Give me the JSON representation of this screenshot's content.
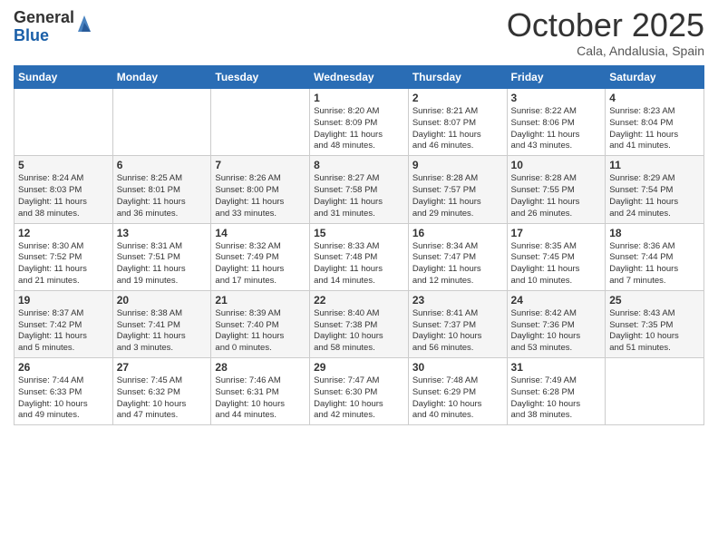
{
  "header": {
    "logo_general": "General",
    "logo_blue": "Blue",
    "month_title": "October 2025",
    "location": "Cala, Andalusia, Spain"
  },
  "days_of_week": [
    "Sunday",
    "Monday",
    "Tuesday",
    "Wednesday",
    "Thursday",
    "Friday",
    "Saturday"
  ],
  "weeks": [
    [
      {
        "day": "",
        "info": ""
      },
      {
        "day": "",
        "info": ""
      },
      {
        "day": "",
        "info": ""
      },
      {
        "day": "1",
        "info": "Sunrise: 8:20 AM\nSunset: 8:09 PM\nDaylight: 11 hours\nand 48 minutes."
      },
      {
        "day": "2",
        "info": "Sunrise: 8:21 AM\nSunset: 8:07 PM\nDaylight: 11 hours\nand 46 minutes."
      },
      {
        "day": "3",
        "info": "Sunrise: 8:22 AM\nSunset: 8:06 PM\nDaylight: 11 hours\nand 43 minutes."
      },
      {
        "day": "4",
        "info": "Sunrise: 8:23 AM\nSunset: 8:04 PM\nDaylight: 11 hours\nand 41 minutes."
      }
    ],
    [
      {
        "day": "5",
        "info": "Sunrise: 8:24 AM\nSunset: 8:03 PM\nDaylight: 11 hours\nand 38 minutes."
      },
      {
        "day": "6",
        "info": "Sunrise: 8:25 AM\nSunset: 8:01 PM\nDaylight: 11 hours\nand 36 minutes."
      },
      {
        "day": "7",
        "info": "Sunrise: 8:26 AM\nSunset: 8:00 PM\nDaylight: 11 hours\nand 33 minutes."
      },
      {
        "day": "8",
        "info": "Sunrise: 8:27 AM\nSunset: 7:58 PM\nDaylight: 11 hours\nand 31 minutes."
      },
      {
        "day": "9",
        "info": "Sunrise: 8:28 AM\nSunset: 7:57 PM\nDaylight: 11 hours\nand 29 minutes."
      },
      {
        "day": "10",
        "info": "Sunrise: 8:28 AM\nSunset: 7:55 PM\nDaylight: 11 hours\nand 26 minutes."
      },
      {
        "day": "11",
        "info": "Sunrise: 8:29 AM\nSunset: 7:54 PM\nDaylight: 11 hours\nand 24 minutes."
      }
    ],
    [
      {
        "day": "12",
        "info": "Sunrise: 8:30 AM\nSunset: 7:52 PM\nDaylight: 11 hours\nand 21 minutes."
      },
      {
        "day": "13",
        "info": "Sunrise: 8:31 AM\nSunset: 7:51 PM\nDaylight: 11 hours\nand 19 minutes."
      },
      {
        "day": "14",
        "info": "Sunrise: 8:32 AM\nSunset: 7:49 PM\nDaylight: 11 hours\nand 17 minutes."
      },
      {
        "day": "15",
        "info": "Sunrise: 8:33 AM\nSunset: 7:48 PM\nDaylight: 11 hours\nand 14 minutes."
      },
      {
        "day": "16",
        "info": "Sunrise: 8:34 AM\nSunset: 7:47 PM\nDaylight: 11 hours\nand 12 minutes."
      },
      {
        "day": "17",
        "info": "Sunrise: 8:35 AM\nSunset: 7:45 PM\nDaylight: 11 hours\nand 10 minutes."
      },
      {
        "day": "18",
        "info": "Sunrise: 8:36 AM\nSunset: 7:44 PM\nDaylight: 11 hours\nand 7 minutes."
      }
    ],
    [
      {
        "day": "19",
        "info": "Sunrise: 8:37 AM\nSunset: 7:42 PM\nDaylight: 11 hours\nand 5 minutes."
      },
      {
        "day": "20",
        "info": "Sunrise: 8:38 AM\nSunset: 7:41 PM\nDaylight: 11 hours\nand 3 minutes."
      },
      {
        "day": "21",
        "info": "Sunrise: 8:39 AM\nSunset: 7:40 PM\nDaylight: 11 hours\nand 0 minutes."
      },
      {
        "day": "22",
        "info": "Sunrise: 8:40 AM\nSunset: 7:38 PM\nDaylight: 10 hours\nand 58 minutes."
      },
      {
        "day": "23",
        "info": "Sunrise: 8:41 AM\nSunset: 7:37 PM\nDaylight: 10 hours\nand 56 minutes."
      },
      {
        "day": "24",
        "info": "Sunrise: 8:42 AM\nSunset: 7:36 PM\nDaylight: 10 hours\nand 53 minutes."
      },
      {
        "day": "25",
        "info": "Sunrise: 8:43 AM\nSunset: 7:35 PM\nDaylight: 10 hours\nand 51 minutes."
      }
    ],
    [
      {
        "day": "26",
        "info": "Sunrise: 7:44 AM\nSunset: 6:33 PM\nDaylight: 10 hours\nand 49 minutes."
      },
      {
        "day": "27",
        "info": "Sunrise: 7:45 AM\nSunset: 6:32 PM\nDaylight: 10 hours\nand 47 minutes."
      },
      {
        "day": "28",
        "info": "Sunrise: 7:46 AM\nSunset: 6:31 PM\nDaylight: 10 hours\nand 44 minutes."
      },
      {
        "day": "29",
        "info": "Sunrise: 7:47 AM\nSunset: 6:30 PM\nDaylight: 10 hours\nand 42 minutes."
      },
      {
        "day": "30",
        "info": "Sunrise: 7:48 AM\nSunset: 6:29 PM\nDaylight: 10 hours\nand 40 minutes."
      },
      {
        "day": "31",
        "info": "Sunrise: 7:49 AM\nSunset: 6:28 PM\nDaylight: 10 hours\nand 38 minutes."
      },
      {
        "day": "",
        "info": ""
      }
    ]
  ]
}
